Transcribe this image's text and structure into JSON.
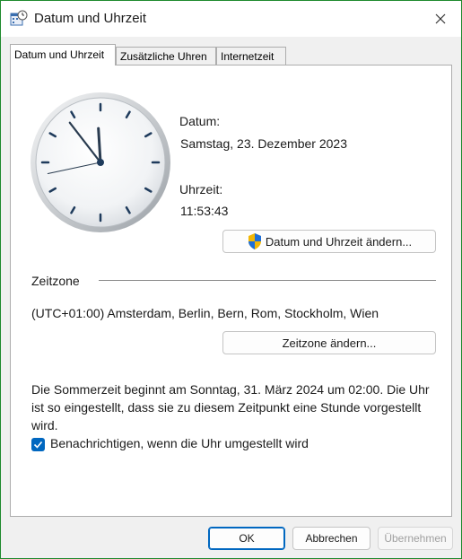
{
  "window": {
    "title": "Datum und Uhrzeit",
    "icons": {
      "app": "calendar-clock-icon",
      "close": "close-icon"
    }
  },
  "tabs": [
    {
      "label": "Datum und Uhrzeit",
      "active": true
    },
    {
      "label": "Zusätzliche Uhren",
      "active": false
    },
    {
      "label": "Internetzeit",
      "active": false
    }
  ],
  "datetime": {
    "date_label": "Datum:",
    "date_value": "Samstag, 23. Dezember 2023",
    "time_label": "Uhrzeit:",
    "time_value": "11:53:43",
    "change_button": "Datum und Uhrzeit ändern...",
    "change_icon": "uac-shield-icon"
  },
  "timezone": {
    "heading": "Zeitzone",
    "value": "(UTC+01:00) Amsterdam, Berlin, Bern, Rom, Stockholm, Wien",
    "change_button": "Zeitzone ändern..."
  },
  "dst": {
    "info": "Die Sommerzeit beginnt am Sonntag, 31. März 2024 um 02:00. Die Uhr ist so eingestellt, dass sie zu diesem Zeitpunkt eine Stunde vorgestellt wird.",
    "notify_label": "Benachrichtigen, wenn die Uhr umgestellt wird",
    "notify_checked": true
  },
  "footer": {
    "ok": "OK",
    "cancel": "Abbrechen",
    "apply": "Übernehmen"
  },
  "colors": {
    "accent": "#0067c0",
    "window_border": "#1f8a2e"
  }
}
